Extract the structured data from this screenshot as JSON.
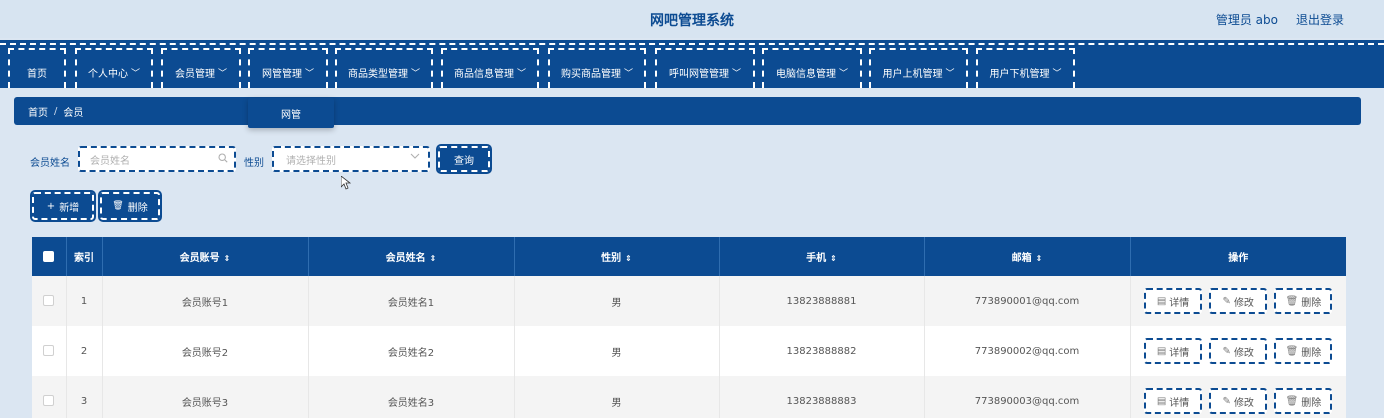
{
  "header": {
    "title": "网吧管理系统",
    "admin": "管理员 abo",
    "logout": "退出登录"
  },
  "nav": {
    "items": [
      {
        "label": "首页",
        "chev": ""
      },
      {
        "label": "个人中心",
        "chev": "﹀"
      },
      {
        "label": "会员管理",
        "chev": "﹀"
      },
      {
        "label": "网管管理",
        "chev": "﹀"
      },
      {
        "label": "商品类型管理",
        "chev": "﹀"
      },
      {
        "label": "商品信息管理",
        "chev": "﹀"
      },
      {
        "label": "购买商品管理",
        "chev": "﹀"
      },
      {
        "label": "呼叫网管管理",
        "chev": "﹀"
      },
      {
        "label": "电脑信息管理",
        "chev": "﹀"
      },
      {
        "label": "用户上机管理",
        "chev": "﹀"
      },
      {
        "label": "用户下机管理",
        "chev": "﹀"
      }
    ],
    "dropdown_item": "网管"
  },
  "breadcrumb": {
    "home": "首页",
    "separator": "/",
    "current": "会员"
  },
  "search": {
    "name_label": "会员姓名",
    "name_placeholder": "会员姓名",
    "gender_label": "性别",
    "gender_placeholder": "请选择性别",
    "query_label": "查询"
  },
  "actions": {
    "add_label": "新增",
    "delete_label": "删除",
    "add_icon": "+",
    "delete_icon": "🗑"
  },
  "table": {
    "columns": {
      "index": "索引",
      "account": "会员账号",
      "name": "会员姓名",
      "gender": "性别",
      "phone": "手机",
      "email": "邮箱",
      "ops": "操作"
    },
    "sort_icon": "⇕",
    "rows": [
      {
        "index": "1",
        "account": "会员账号1",
        "name": "会员姓名1",
        "gender": "男",
        "phone": "13823888881",
        "email": "773890001@qq.com"
      },
      {
        "index": "2",
        "account": "会员账号2",
        "name": "会员姓名2",
        "gender": "男",
        "phone": "13823888882",
        "email": "773890002@qq.com"
      },
      {
        "index": "3",
        "account": "会员账号3",
        "name": "会员姓名3",
        "gender": "男",
        "phone": "13823888883",
        "email": "773890003@qq.com"
      }
    ],
    "op_labels": {
      "detail": "详情",
      "edit": "修改",
      "delete": "删除"
    }
  },
  "colors": {
    "primary": "#0c4b92",
    "background": "#dbe6f2"
  }
}
